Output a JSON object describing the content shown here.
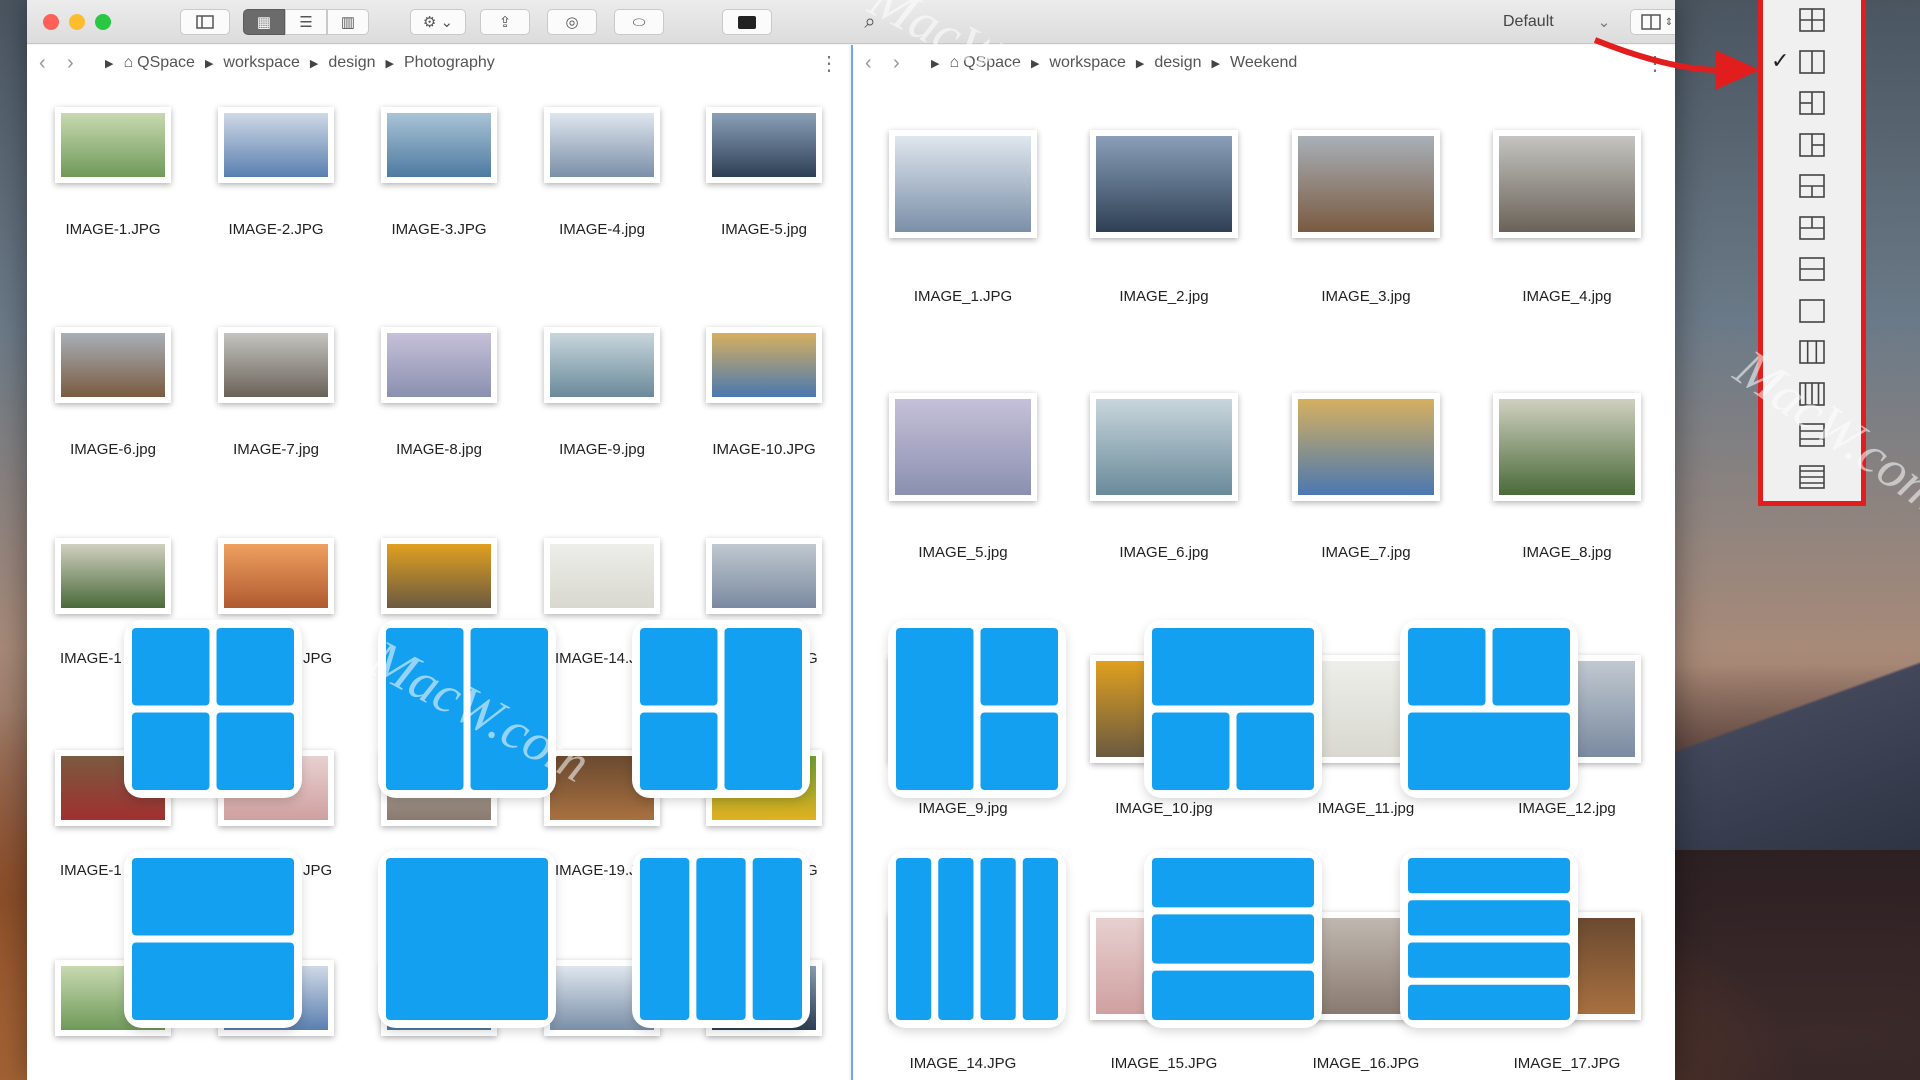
{
  "toolbar": {
    "default_label": "Default",
    "gear_icon": "gear-icon",
    "search_icon": "search-icon",
    "terminal_icon": "terminal-icon"
  },
  "left_pane": {
    "path": [
      "QSpace",
      "workspace",
      "design",
      "Photography"
    ],
    "files": [
      "IMAGE-1.JPG",
      "IMAGE-2.JPG",
      "IMAGE-3.JPG",
      "IMAGE-4.jpg",
      "IMAGE-5.jpg",
      "IMAGE-6.jpg",
      "IMAGE-7.jpg",
      "IMAGE-8.jpg",
      "IMAGE-9.jpg",
      "IMAGE-10.JPG",
      "IMAGE-1",
      "JPG",
      "IMAGE-14.J",
      "G",
      "IMAGE-1",
      "JPG",
      "IMAGE-19.J",
      "G"
    ]
  },
  "right_pane": {
    "path": [
      "QSpace",
      "workspace",
      "design",
      "Weekend"
    ],
    "files": [
      "IMAGE_1.JPG",
      "IMAGE_2.jpg",
      "IMAGE_3.jpg",
      "IMAGE_4.jpg",
      "IMAGE_5.jpg",
      "IMAGE_6.jpg",
      "IMAGE_7.jpg",
      "IMAGE_8.jpg",
      "IMAGE_9.jpg",
      "IMAGE_10.jpg",
      "IMAGE_11.jpg",
      "IMAGE_12.jpg",
      "IMAGE_14.JPG",
      "IMAGE_15.JPG",
      "IMAGE_16.JPG",
      "IMAGE_17.JPG"
    ]
  },
  "layout_menu": {
    "checkmark": "✓",
    "selected_index": 1,
    "count": 12
  },
  "watermark": "MacW.com",
  "colors": {
    "accent_blue": "#14a0f0",
    "menu_border": "#e21d1d",
    "arrow": "#e21d1d"
  }
}
